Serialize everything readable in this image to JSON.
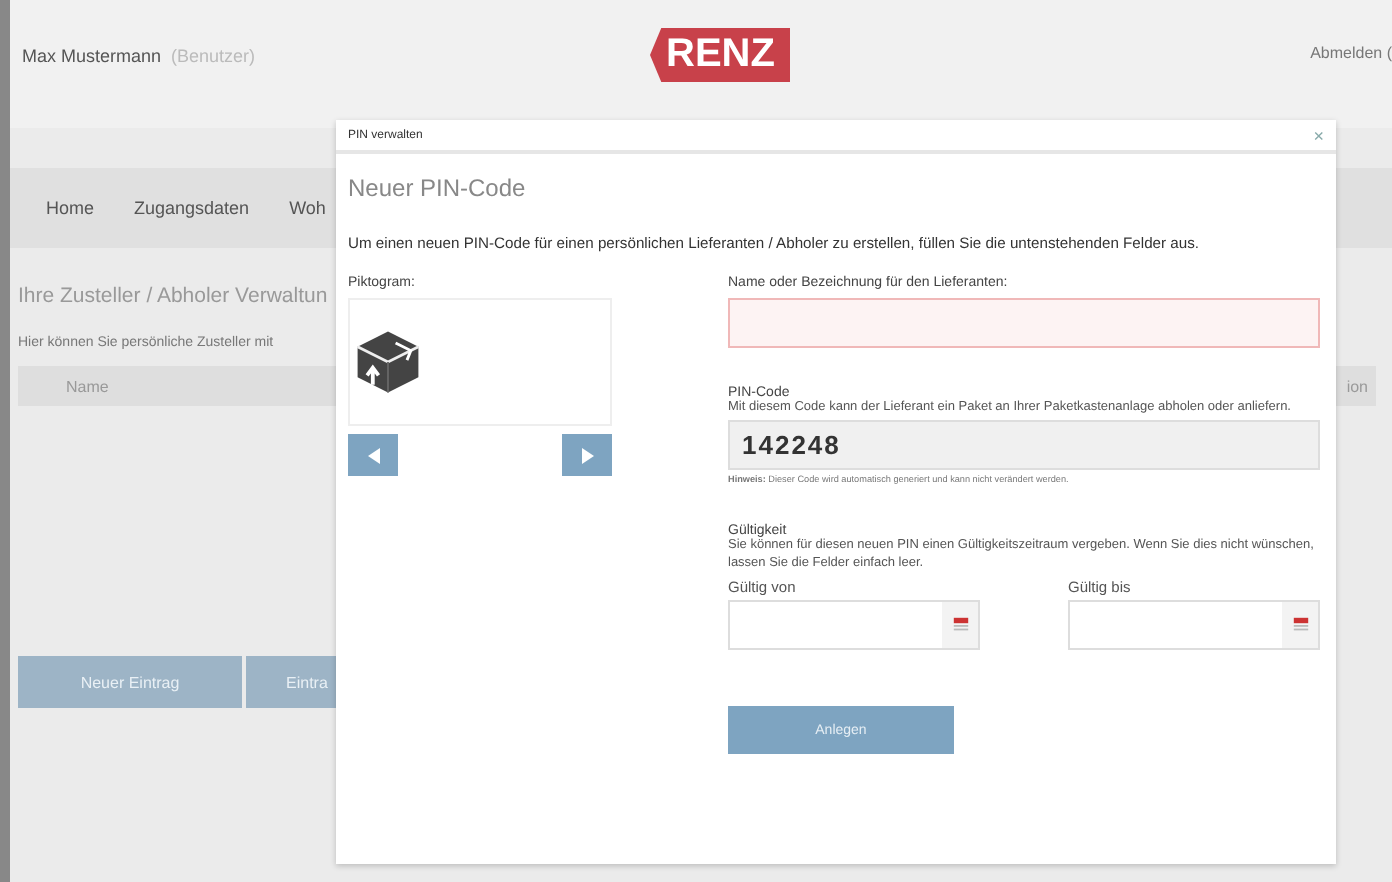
{
  "header": {
    "user_name": "Max Mustermann",
    "user_role": "(Benutzer)",
    "logo_text": "RENZ",
    "logout": "Abmelden ("
  },
  "nav": [
    {
      "label": "Home"
    },
    {
      "label": "Zugangsdaten"
    },
    {
      "label": "Woh"
    }
  ],
  "page": {
    "title": "Ihre Zusteller / Abholer Verwaltun",
    "description": "Hier können Sie persönliche Zusteller mit",
    "table": {
      "column_1": "Name",
      "column_2": "ion"
    },
    "buttons": [
      "Neuer Eintrag",
      "Eintra"
    ]
  },
  "dialog": {
    "title": "PIN verwalten",
    "close": "×",
    "heading": "Neuer PIN-Code",
    "intro": "Um einen neuen PIN-Code für einen persönlichen Lieferanten / Abholer zu erstellen, füllen Sie die untenstehenden Felder aus.",
    "pictogram_label": "Piktogram:",
    "name_field": {
      "label": "Name oder Bezeichnung für den Lieferanten:",
      "invalid": true
    },
    "pin": {
      "label": "PIN-Code",
      "description": "Mit diesem Code kann der Lieferant ein Paket an Ihrer Paketkastenanlage abholen oder anliefern.",
      "value": "142248",
      "hint": "**Hinweis:** Dieser Code wird automatisch generiert und kann nicht verändert werden."
    },
    "validity": {
      "label": "Gültigkeit",
      "description": "Sie können für diesen neuen PIN einen Gültigkeitszeitraum vergeben. Wenn Sie dies nicht wünschen, lassen Sie die Felder einfach leer.",
      "from_label": "Gültig von",
      "to_label": "Gültig bis"
    },
    "submit": "Anlegen"
  }
}
